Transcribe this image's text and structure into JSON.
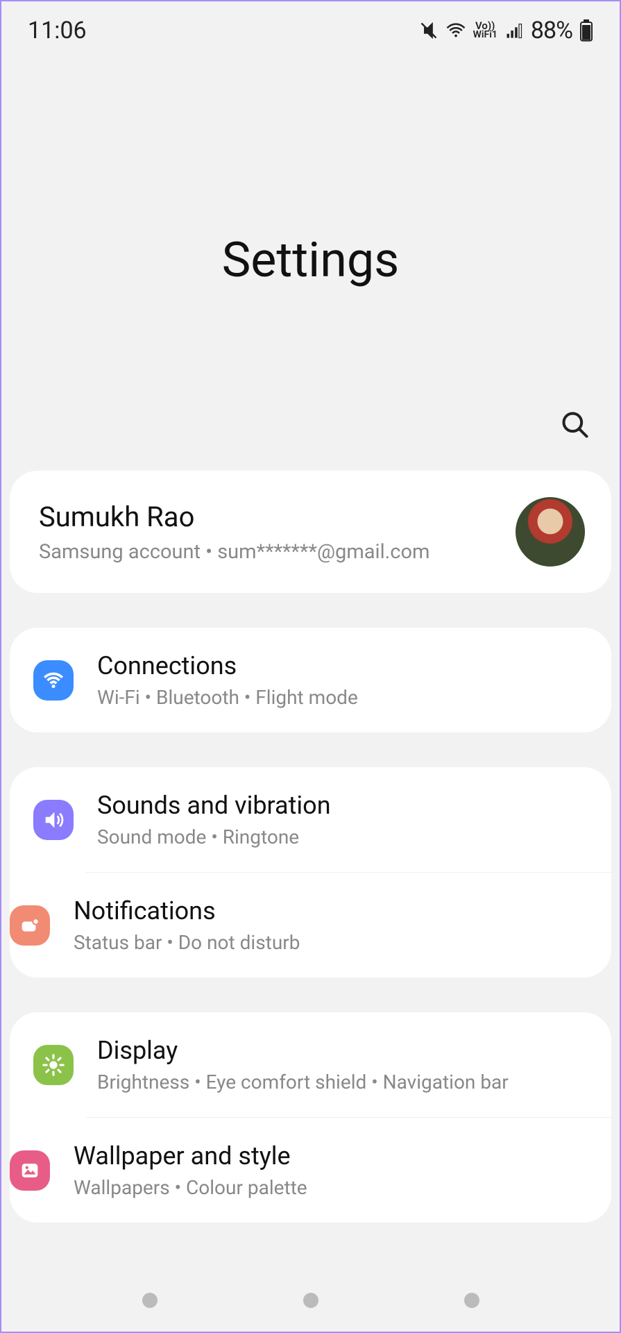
{
  "status": {
    "time": "11:06",
    "vowifi_top": "Vo))",
    "vowifi_bottom": "WiFi1",
    "battery": "88%"
  },
  "header": {
    "title": "Settings"
  },
  "account": {
    "name": "Sumukh Rao",
    "sub": "Samsung account  •  sum*******@gmail.com"
  },
  "groups": [
    {
      "items": [
        {
          "icon": "wifi",
          "color": "ic-blue",
          "title": "Connections",
          "sub": "Wi-Fi  •  Bluetooth  •  Flight mode"
        }
      ]
    },
    {
      "items": [
        {
          "icon": "sound",
          "color": "ic-purple",
          "title": "Sounds and vibration",
          "sub": "Sound mode  •  Ringtone"
        },
        {
          "icon": "bell",
          "color": "ic-salmon",
          "title": "Notifications",
          "sub": "Status bar  •  Do not disturb"
        }
      ]
    },
    {
      "items": [
        {
          "icon": "sun",
          "color": "ic-green",
          "title": "Display",
          "sub": "Brightness  •  Eye comfort shield  •  Navigation bar"
        },
        {
          "icon": "picture",
          "color": "ic-pink",
          "title": "Wallpaper and style",
          "sub": "Wallpapers  •  Colour palette"
        }
      ]
    }
  ]
}
